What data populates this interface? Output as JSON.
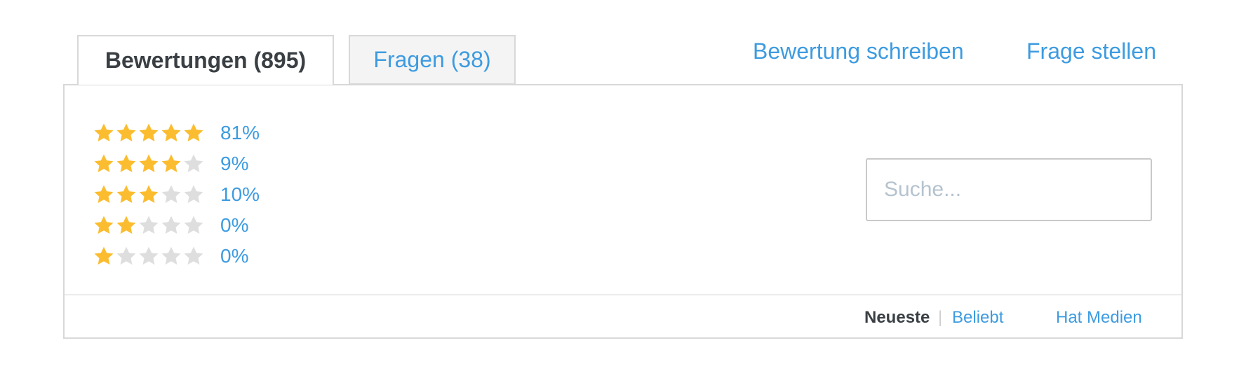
{
  "tabs": {
    "reviews_label": "Bewertungen (895)",
    "questions_label": "Fragen (38)"
  },
  "actions": {
    "write_review": "Bewertung schreiben",
    "ask_question": "Frage stellen"
  },
  "ratings": [
    {
      "stars": 5,
      "percent": "81%"
    },
    {
      "stars": 4,
      "percent": "9%"
    },
    {
      "stars": 3,
      "percent": "10%"
    },
    {
      "stars": 2,
      "percent": "0%"
    },
    {
      "stars": 1,
      "percent": "0%"
    }
  ],
  "search": {
    "placeholder": "Suche..."
  },
  "sort": {
    "newest": "Neueste",
    "separator": "|",
    "popular": "Beliebt",
    "has_media": "Hat Medien"
  },
  "colors": {
    "accent": "#3d9be0",
    "star_filled": "#fbbd2f",
    "star_empty": "#dedede",
    "text_dark": "#3a3f44",
    "border": "#d8d8d8"
  },
  "icons": {
    "star": "star-icon"
  }
}
